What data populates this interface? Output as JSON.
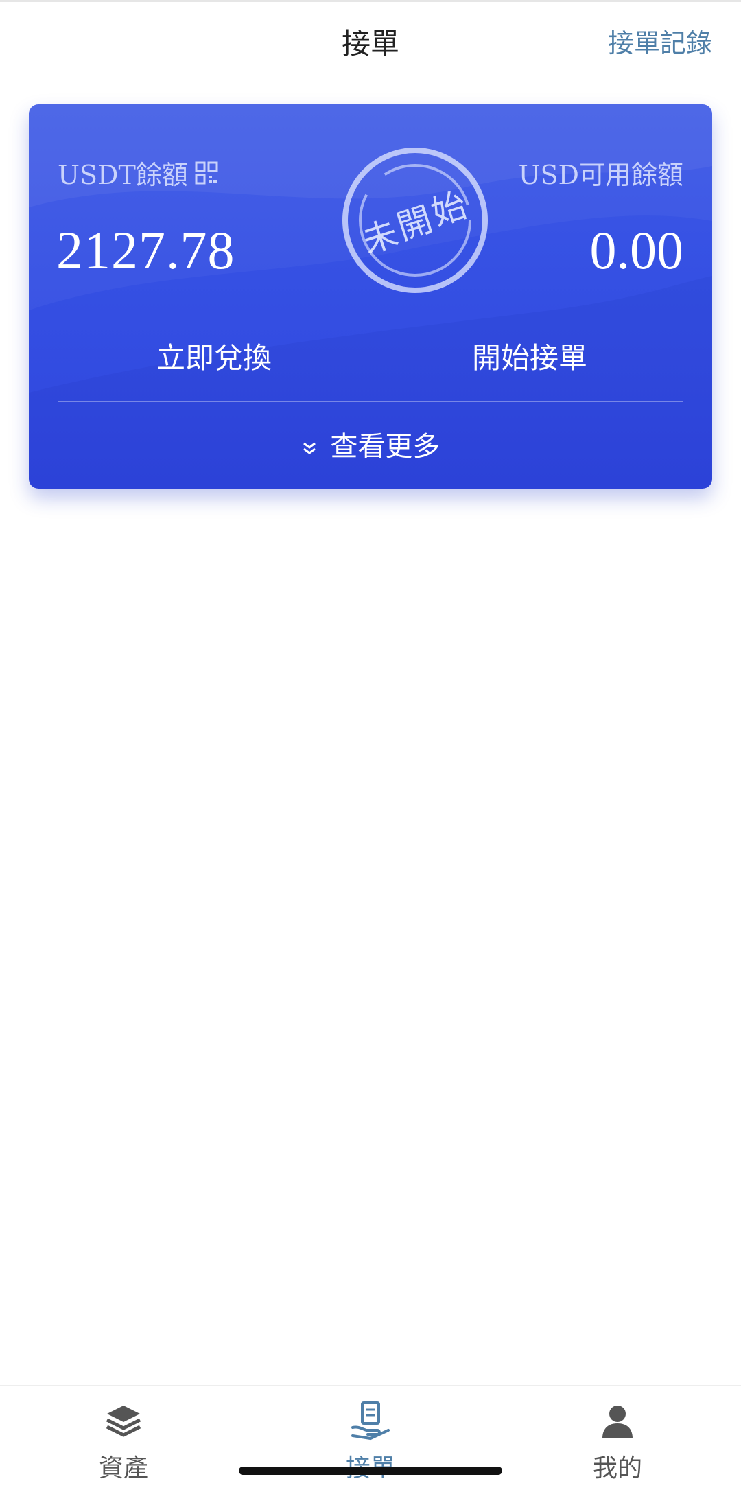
{
  "header": {
    "title": "接單",
    "right_link": "接單記錄"
  },
  "card": {
    "left_label": "USDT餘額",
    "left_amount": "2127.78",
    "right_label": "USD可用餘額",
    "right_amount": "0.00",
    "stamp_text": [
      "未",
      "開",
      "始"
    ],
    "actions": {
      "exchange": "立即兌換",
      "start": "開始接單"
    },
    "more": "查看更多",
    "colors": {
      "gradient_top": "#3e5ae6",
      "gradient_bottom": "#2f46de"
    }
  },
  "bottom_nav": {
    "items": [
      {
        "label": "資產",
        "icon": "layers-icon",
        "active": false
      },
      {
        "label": "接單",
        "icon": "order-hand-icon",
        "active": true
      },
      {
        "label": "我的",
        "icon": "person-icon",
        "active": false
      }
    ],
    "active_color": "#4f7fa8"
  }
}
